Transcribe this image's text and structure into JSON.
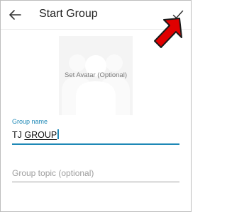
{
  "header": {
    "title": "Start Group"
  },
  "avatar": {
    "label": "Set Avatar (Optional)"
  },
  "group_name": {
    "label": "Group name",
    "value_prefix": "TJ ",
    "value_suggest": "GROUP"
  },
  "group_topic": {
    "placeholder": "Group topic (optional)"
  },
  "colors": {
    "accent": "#1e88b6",
    "annotation_arrow": "#e00000"
  },
  "icons": {
    "back": "arrow-back-icon",
    "confirm": "checkmark-icon",
    "avatar": "group-silhouette-icon",
    "annotation": "red-pointer-arrow"
  }
}
